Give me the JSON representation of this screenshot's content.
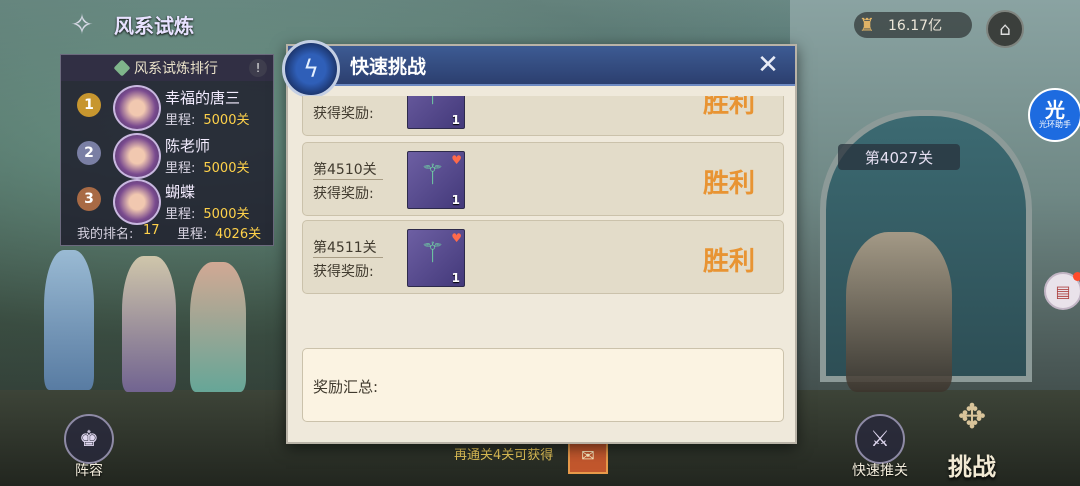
{
  "top": {
    "title": "风系试炼",
    "currency": "16.17亿"
  },
  "ranking": {
    "header": "风系试炼排行",
    "prog_label": "里程:",
    "entries": [
      {
        "rank": "1",
        "name": "幸福的唐三",
        "progress": "5000关"
      },
      {
        "rank": "2",
        "name": "陈老师",
        "progress": "5000关"
      },
      {
        "rank": "3",
        "name": "蝴蝶",
        "progress": "5000关"
      }
    ],
    "my_rank_label": "我的排名:",
    "my_rank": "17",
    "my_prog_label": "里程:",
    "my_progress": "4026关"
  },
  "side": {
    "helper_big": "光",
    "helper_small": "光环助手"
  },
  "stage_badge": "第4027关",
  "modal": {
    "title": "快速挑战",
    "reward_label": "获得奖励:",
    "rows": [
      {
        "stage": "",
        "count": "1",
        "result": "胜利"
      },
      {
        "stage": "第4510关",
        "count": "1",
        "result": "胜利"
      },
      {
        "stage": "第4511关",
        "count": "1",
        "result": "胜利"
      }
    ],
    "summary_label": "奖励汇总:"
  },
  "bottom": {
    "lineup_label": "阵容",
    "hint": "再通关4关可获得",
    "quick_push_label": "快速推关",
    "challenge_label": "挑战"
  },
  "colors": {
    "victory": "#e89433",
    "modal_header": "#2c3f6f",
    "gold_text": "#ffd24a"
  }
}
